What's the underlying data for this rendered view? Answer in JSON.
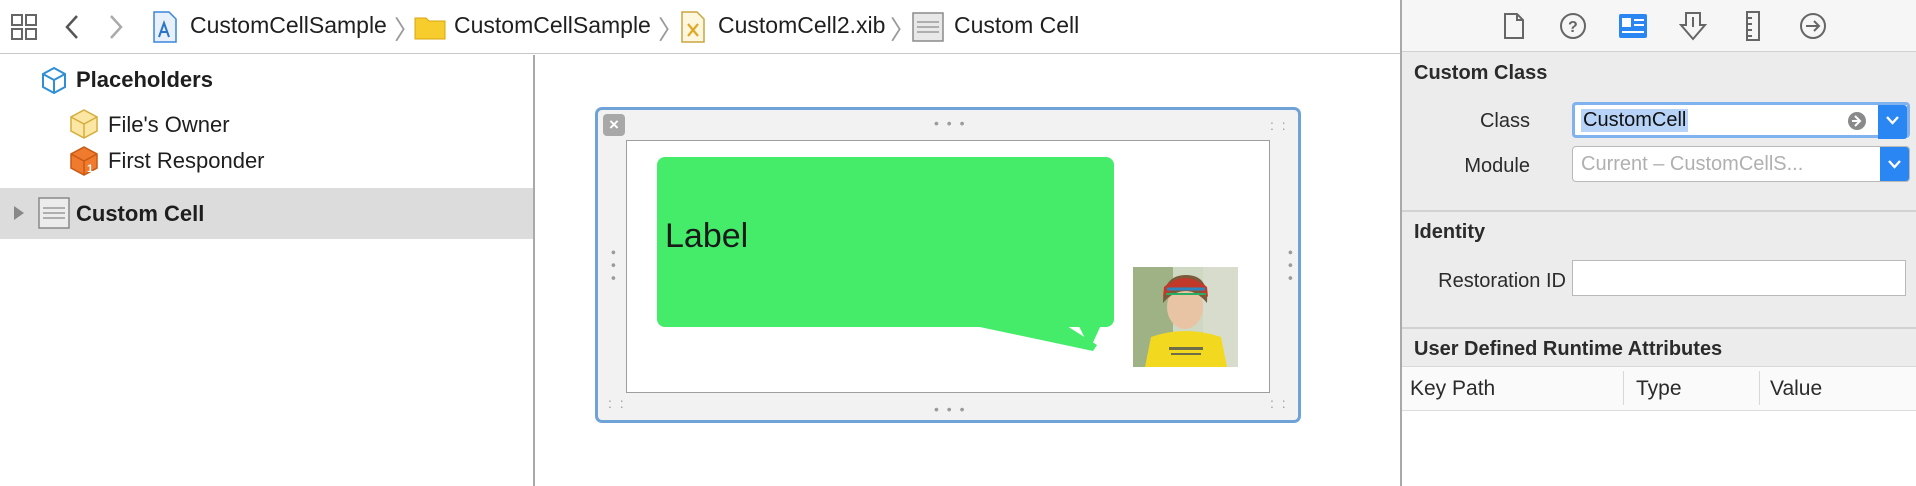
{
  "breadcrumb": {
    "items": [
      {
        "label": "CustomCellSample",
        "icon": "project-file-icon"
      },
      {
        "label": "CustomCellSample",
        "icon": "folder-icon"
      },
      {
        "label": "CustomCell2.xib",
        "icon": "xib-file-icon"
      },
      {
        "label": "Custom Cell",
        "icon": "table-cell-icon"
      }
    ]
  },
  "outline": {
    "placeholders_label": "Placeholders",
    "files_owner_label": "File's Owner",
    "first_responder_label": "First Responder",
    "custom_cell_label": "Custom Cell"
  },
  "canvas": {
    "bubble_label": "Label"
  },
  "inspector": {
    "custom_class": {
      "title": "Custom Class",
      "class_label": "Class",
      "class_value": "CustomCell",
      "module_label": "Module",
      "module_placeholder": "Current – CustomCellS..."
    },
    "identity": {
      "title": "Identity",
      "restoration_label": "Restoration ID",
      "restoration_value": ""
    },
    "runtime_attributes": {
      "title": "User Defined Runtime Attributes",
      "columns": [
        "Key Path",
        "Type",
        "Value"
      ]
    }
  },
  "colors": {
    "accent": "#2a86f2",
    "bubble_green": "#44ec6a",
    "selection_border": "#6fa2d6",
    "selected_row": "#dcdcdc"
  }
}
